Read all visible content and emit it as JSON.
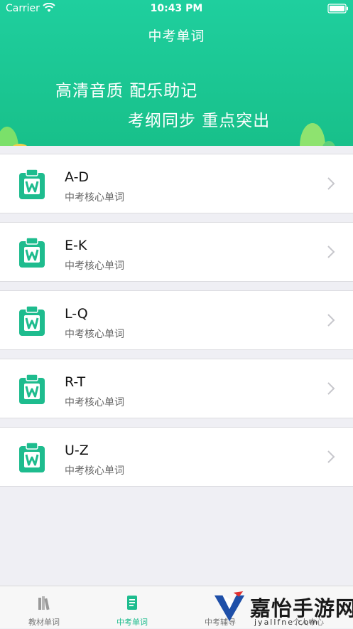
{
  "status_bar": {
    "carrier": "Carrier",
    "time": "10:43 PM"
  },
  "header": {
    "title": "中考单词",
    "slogan_line1": "高清音质 配乐助记",
    "slogan_line2": "考纲同步 重点突出"
  },
  "list": [
    {
      "title": "A-D",
      "subtitle": "中考核心单词"
    },
    {
      "title": "E-K",
      "subtitle": "中考核心单词"
    },
    {
      "title": "L-Q",
      "subtitle": "中考核心单词"
    },
    {
      "title": "R-T",
      "subtitle": "中考核心单词"
    },
    {
      "title": "U-Z",
      "subtitle": "中考核心单词"
    }
  ],
  "tabbar": [
    {
      "label": "教材单词",
      "icon": "books-icon"
    },
    {
      "label": "中考单词",
      "icon": "document-icon",
      "active": true
    },
    {
      "label": "中考辅导",
      "icon": "tutor-icon"
    },
    {
      "label": "个人中心",
      "icon": "person-icon"
    }
  ],
  "watermark": {
    "text": "嘉怡手游网",
    "sub": "jyallfne.com"
  },
  "colors": {
    "accent": "#1ebc8e",
    "header": "#1fcf9e",
    "background": "#efeff4"
  }
}
